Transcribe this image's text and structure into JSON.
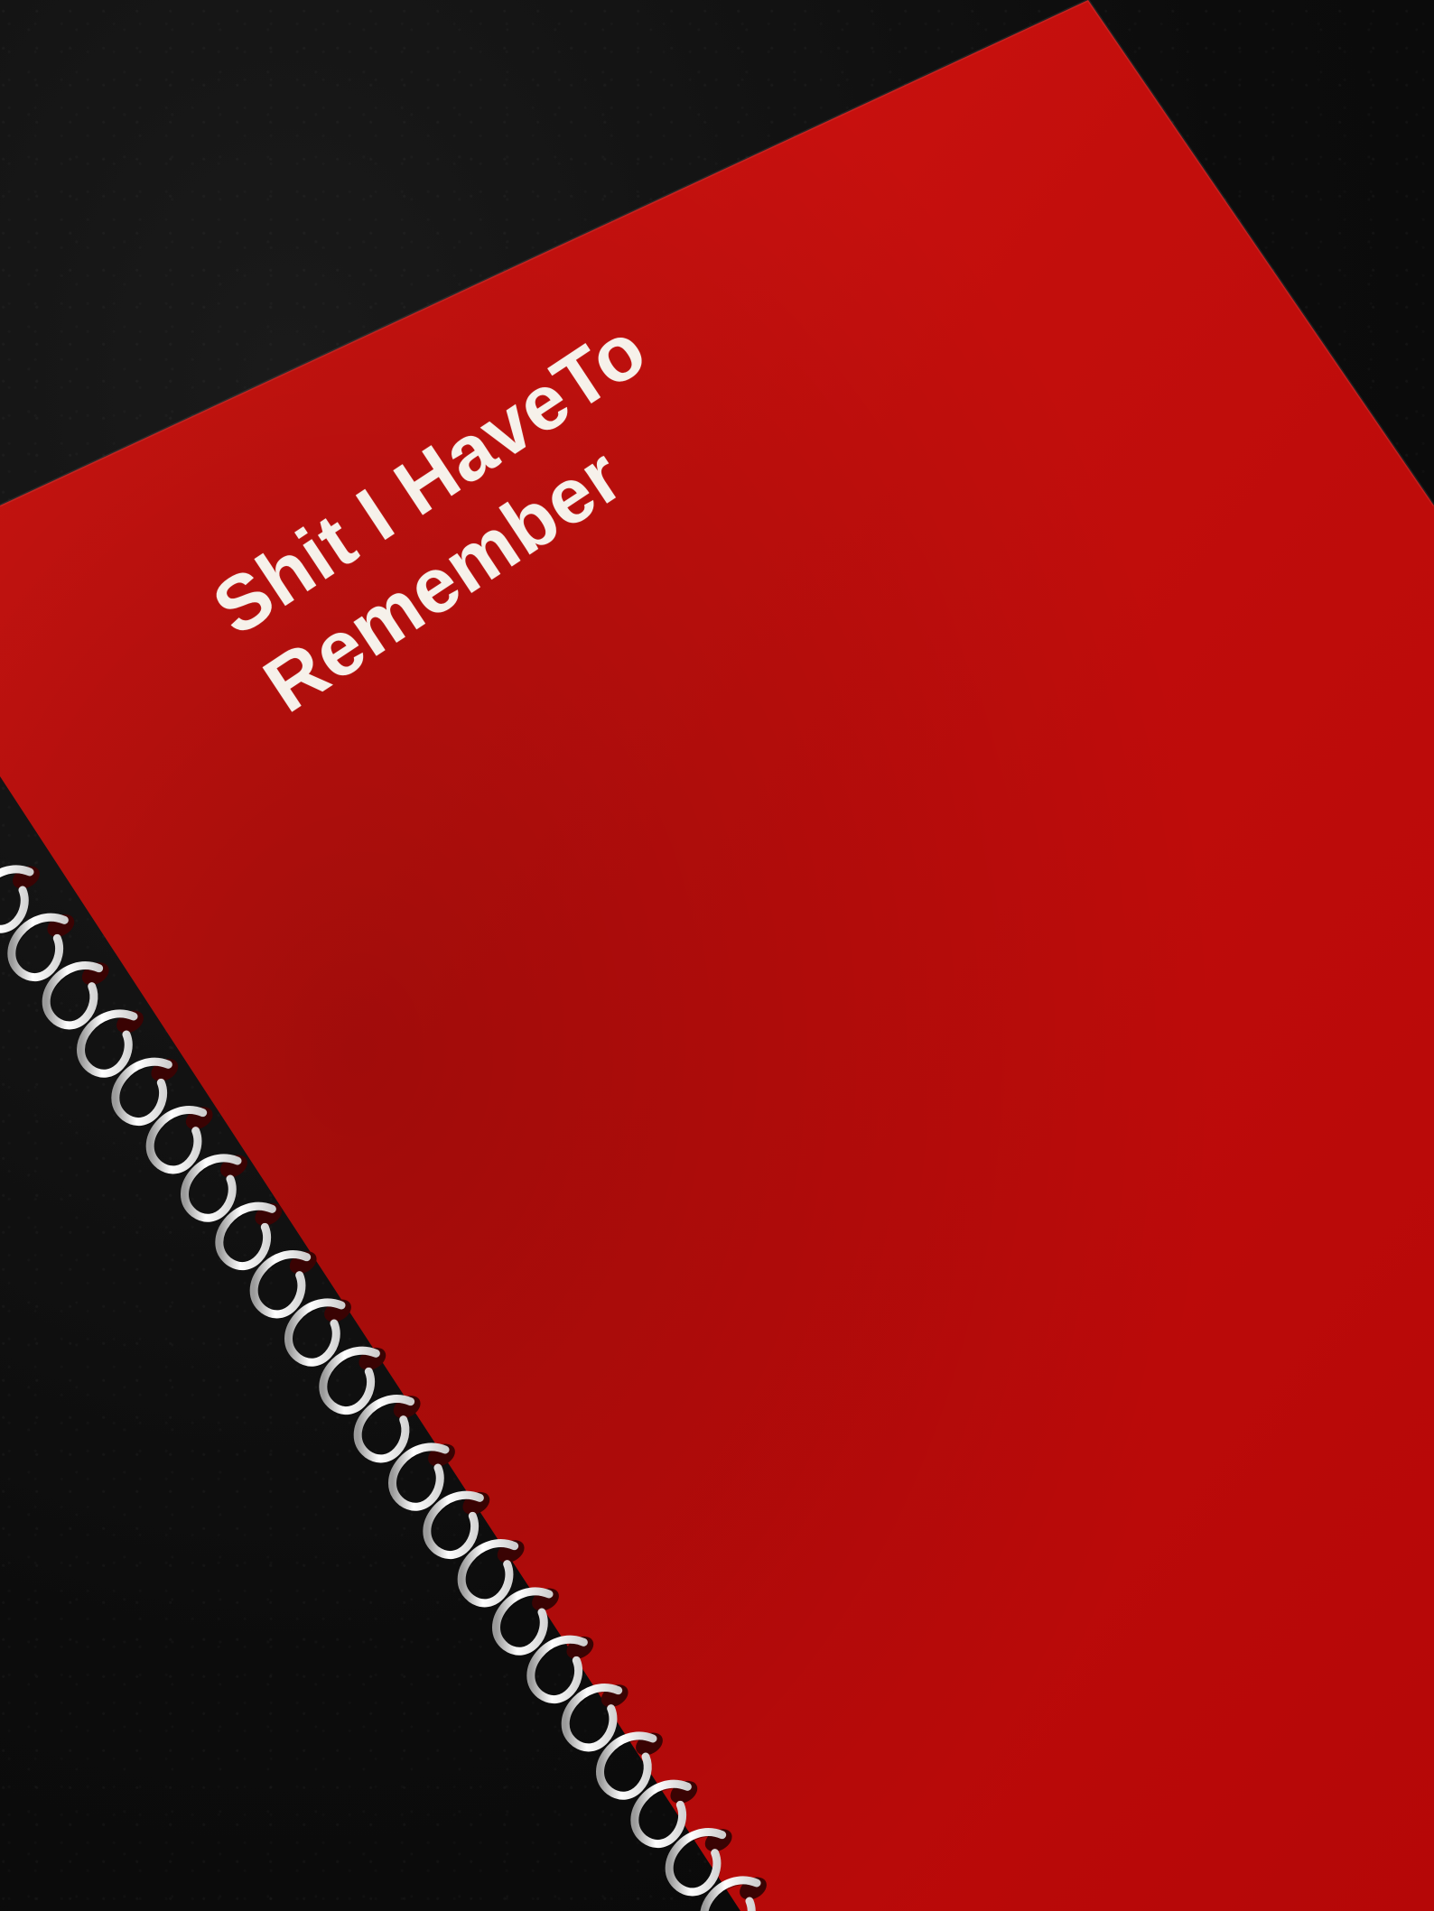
{
  "photo": {
    "subject": "notebook",
    "background_color": "#0d0d0d",
    "cover_color": "#c80a0a",
    "binding_color": "#f2f2f2"
  },
  "cover": {
    "title_line_1": "Shit I HaveTo",
    "title_line_2": "Remember"
  }
}
